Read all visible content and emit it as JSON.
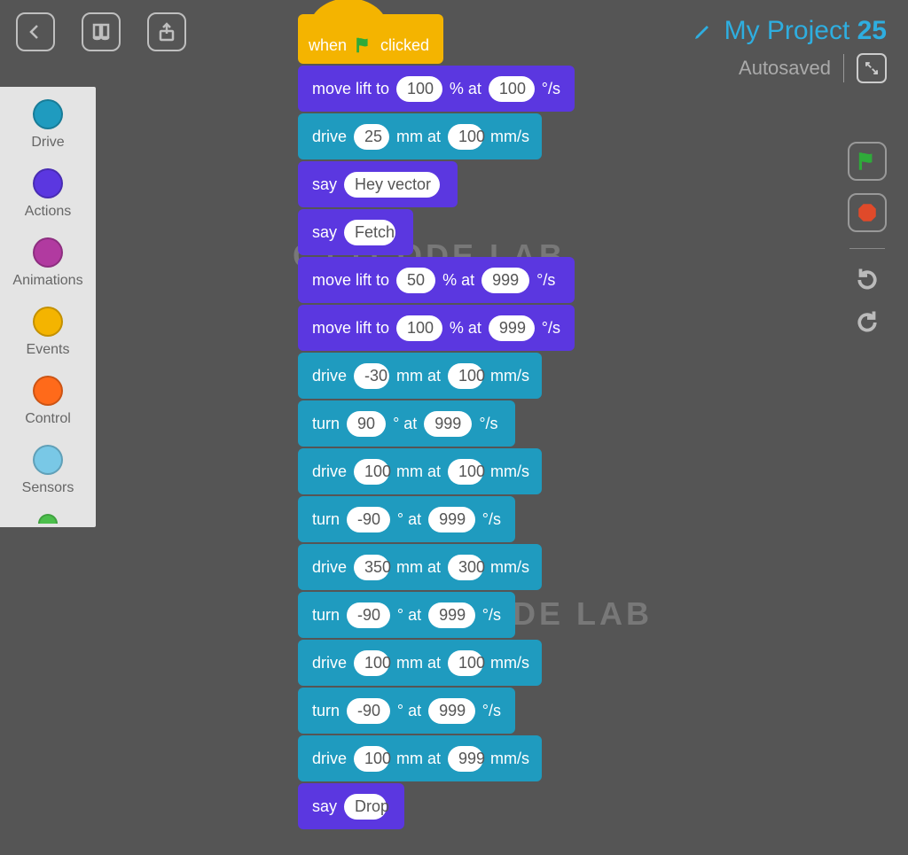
{
  "project": {
    "title": "My Project",
    "number": "25",
    "autosaved": "Autosaved"
  },
  "watermark": "CODE LAB",
  "palette": [
    {
      "name": "Drive",
      "color": "#1f9bbf"
    },
    {
      "name": "Actions",
      "color": "#5b37e0"
    },
    {
      "name": "Animations",
      "color": "#b13aa0"
    },
    {
      "name": "Events",
      "color": "#f4b400"
    },
    {
      "name": "Control",
      "color": "#ff6a1a"
    },
    {
      "name": "Sensors",
      "color": "#79c8e6"
    }
  ],
  "hat": {
    "pre": "when",
    "post": "clicked"
  },
  "blocks": [
    {
      "type": "move_lift",
      "cat": "actions",
      "v1": "100",
      "u1": "% at",
      "v2": "100",
      "u2": "°/s"
    },
    {
      "type": "drive",
      "cat": "drive",
      "v1": "25",
      "u1": "mm at",
      "v2": "100",
      "u2": "mm/s"
    },
    {
      "type": "say",
      "cat": "actions",
      "v1": "Hey vector"
    },
    {
      "type": "say",
      "cat": "actions",
      "v1": "Fetch"
    },
    {
      "type": "move_lift",
      "cat": "actions",
      "v1": "50",
      "u1": "% at",
      "v2": "999",
      "u2": "°/s"
    },
    {
      "type": "move_lift",
      "cat": "actions",
      "v1": "100",
      "u1": "% at",
      "v2": "999",
      "u2": "°/s"
    },
    {
      "type": "drive",
      "cat": "drive",
      "v1": "-30",
      "u1": "mm at",
      "v2": "100",
      "u2": "mm/s"
    },
    {
      "type": "turn",
      "cat": "drive",
      "v1": "90",
      "u1": "° at",
      "v2": "999",
      "u2": "°/s"
    },
    {
      "type": "drive",
      "cat": "drive",
      "v1": "100",
      "u1": "mm at",
      "v2": "100",
      "u2": "mm/s"
    },
    {
      "type": "turn",
      "cat": "drive",
      "v1": "-90",
      "u1": "° at",
      "v2": "999",
      "u2": "°/s"
    },
    {
      "type": "drive",
      "cat": "drive",
      "v1": "350",
      "u1": "mm at",
      "v2": "300",
      "u2": "mm/s"
    },
    {
      "type": "turn",
      "cat": "drive",
      "v1": "-90",
      "u1": "° at",
      "v2": "999",
      "u2": "°/s"
    },
    {
      "type": "drive",
      "cat": "drive",
      "v1": "100",
      "u1": "mm at",
      "v2": "100",
      "u2": "mm/s"
    },
    {
      "type": "turn",
      "cat": "drive",
      "v1": "-90",
      "u1": "° at",
      "v2": "999",
      "u2": "°/s"
    },
    {
      "type": "drive",
      "cat": "drive",
      "v1": "100",
      "u1": "mm at",
      "v2": "999",
      "u2": "mm/s"
    },
    {
      "type": "say",
      "cat": "actions",
      "v1": "Drop"
    }
  ],
  "labels": {
    "move_lift": "move lift to",
    "drive": "drive",
    "turn": "turn",
    "say": "say"
  }
}
